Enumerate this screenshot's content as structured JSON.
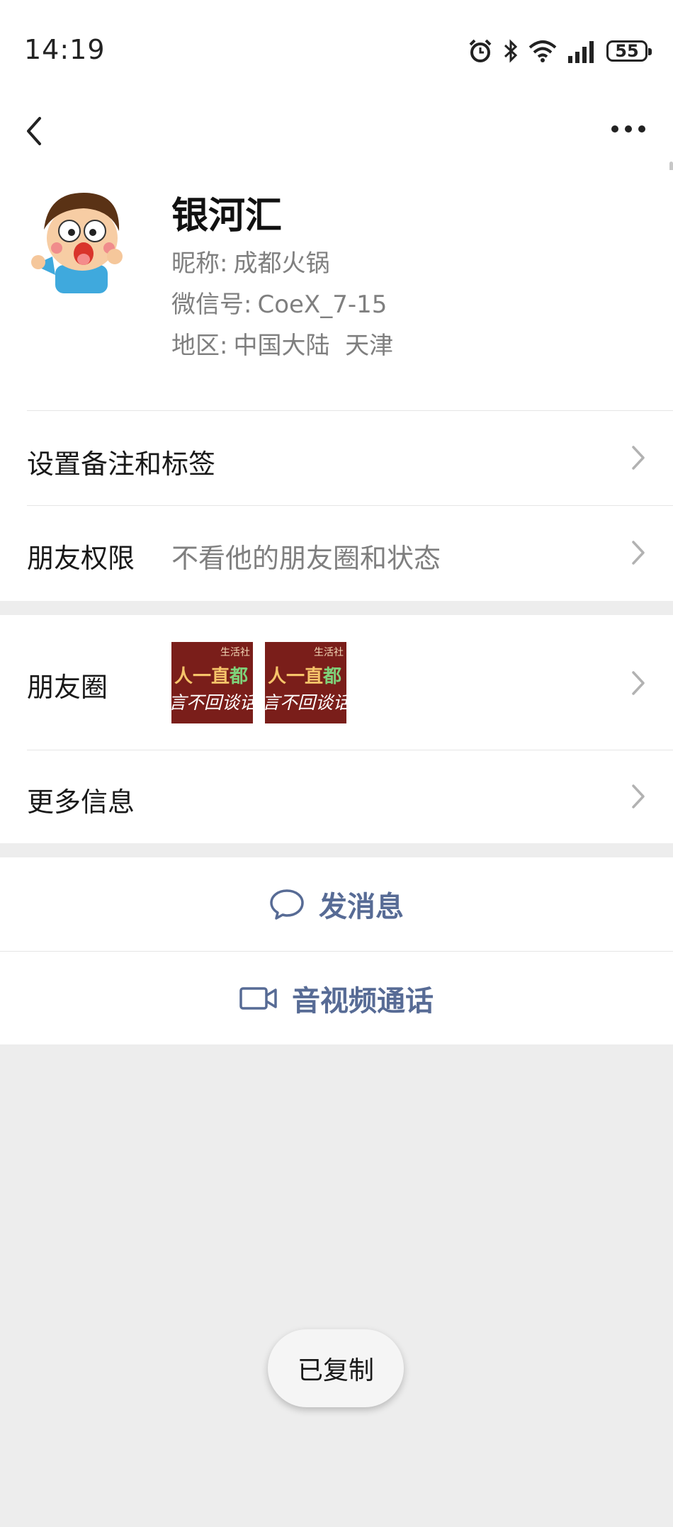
{
  "status_bar": {
    "time": "14:19",
    "battery": "55",
    "icons": [
      "alarm-icon",
      "bluetooth-icon",
      "wifi-icon",
      "signal-icon",
      "battery-icon"
    ]
  },
  "nav": {
    "back_icon": "chevron-left-icon",
    "more_icon": "more-dots-icon"
  },
  "profile": {
    "name": "银河汇",
    "nickname_label": "昵称:",
    "nickname": "成都火锅",
    "wechat_id_label": "微信号:",
    "wechat_id": "CoeX_7-15",
    "region_label": "地区:",
    "region": "中国大陆  天津"
  },
  "settings": {
    "remark_label": "设置备注和标签",
    "permission_label": "朋友权限",
    "permission_value": "不看他的朋友圈和状态"
  },
  "moments": {
    "label": "朋友圈",
    "thumbnails": [
      {
        "line1": "生活社",
        "line2a": "人一直",
        "line2b": "都",
        "line3": "言不回谈话"
      },
      {
        "line1": "生活社",
        "line2a": "人一直",
        "line2b": "都",
        "line3": "言不回谈话"
      }
    ]
  },
  "more_info": {
    "label": "更多信息"
  },
  "actions": {
    "message": "发消息",
    "call": "音视频通话"
  },
  "toast": {
    "text": "已复制"
  },
  "colors": {
    "link_blue": "#576b95",
    "background": "#ededed",
    "thumb_bg": "#7a1e1a"
  }
}
